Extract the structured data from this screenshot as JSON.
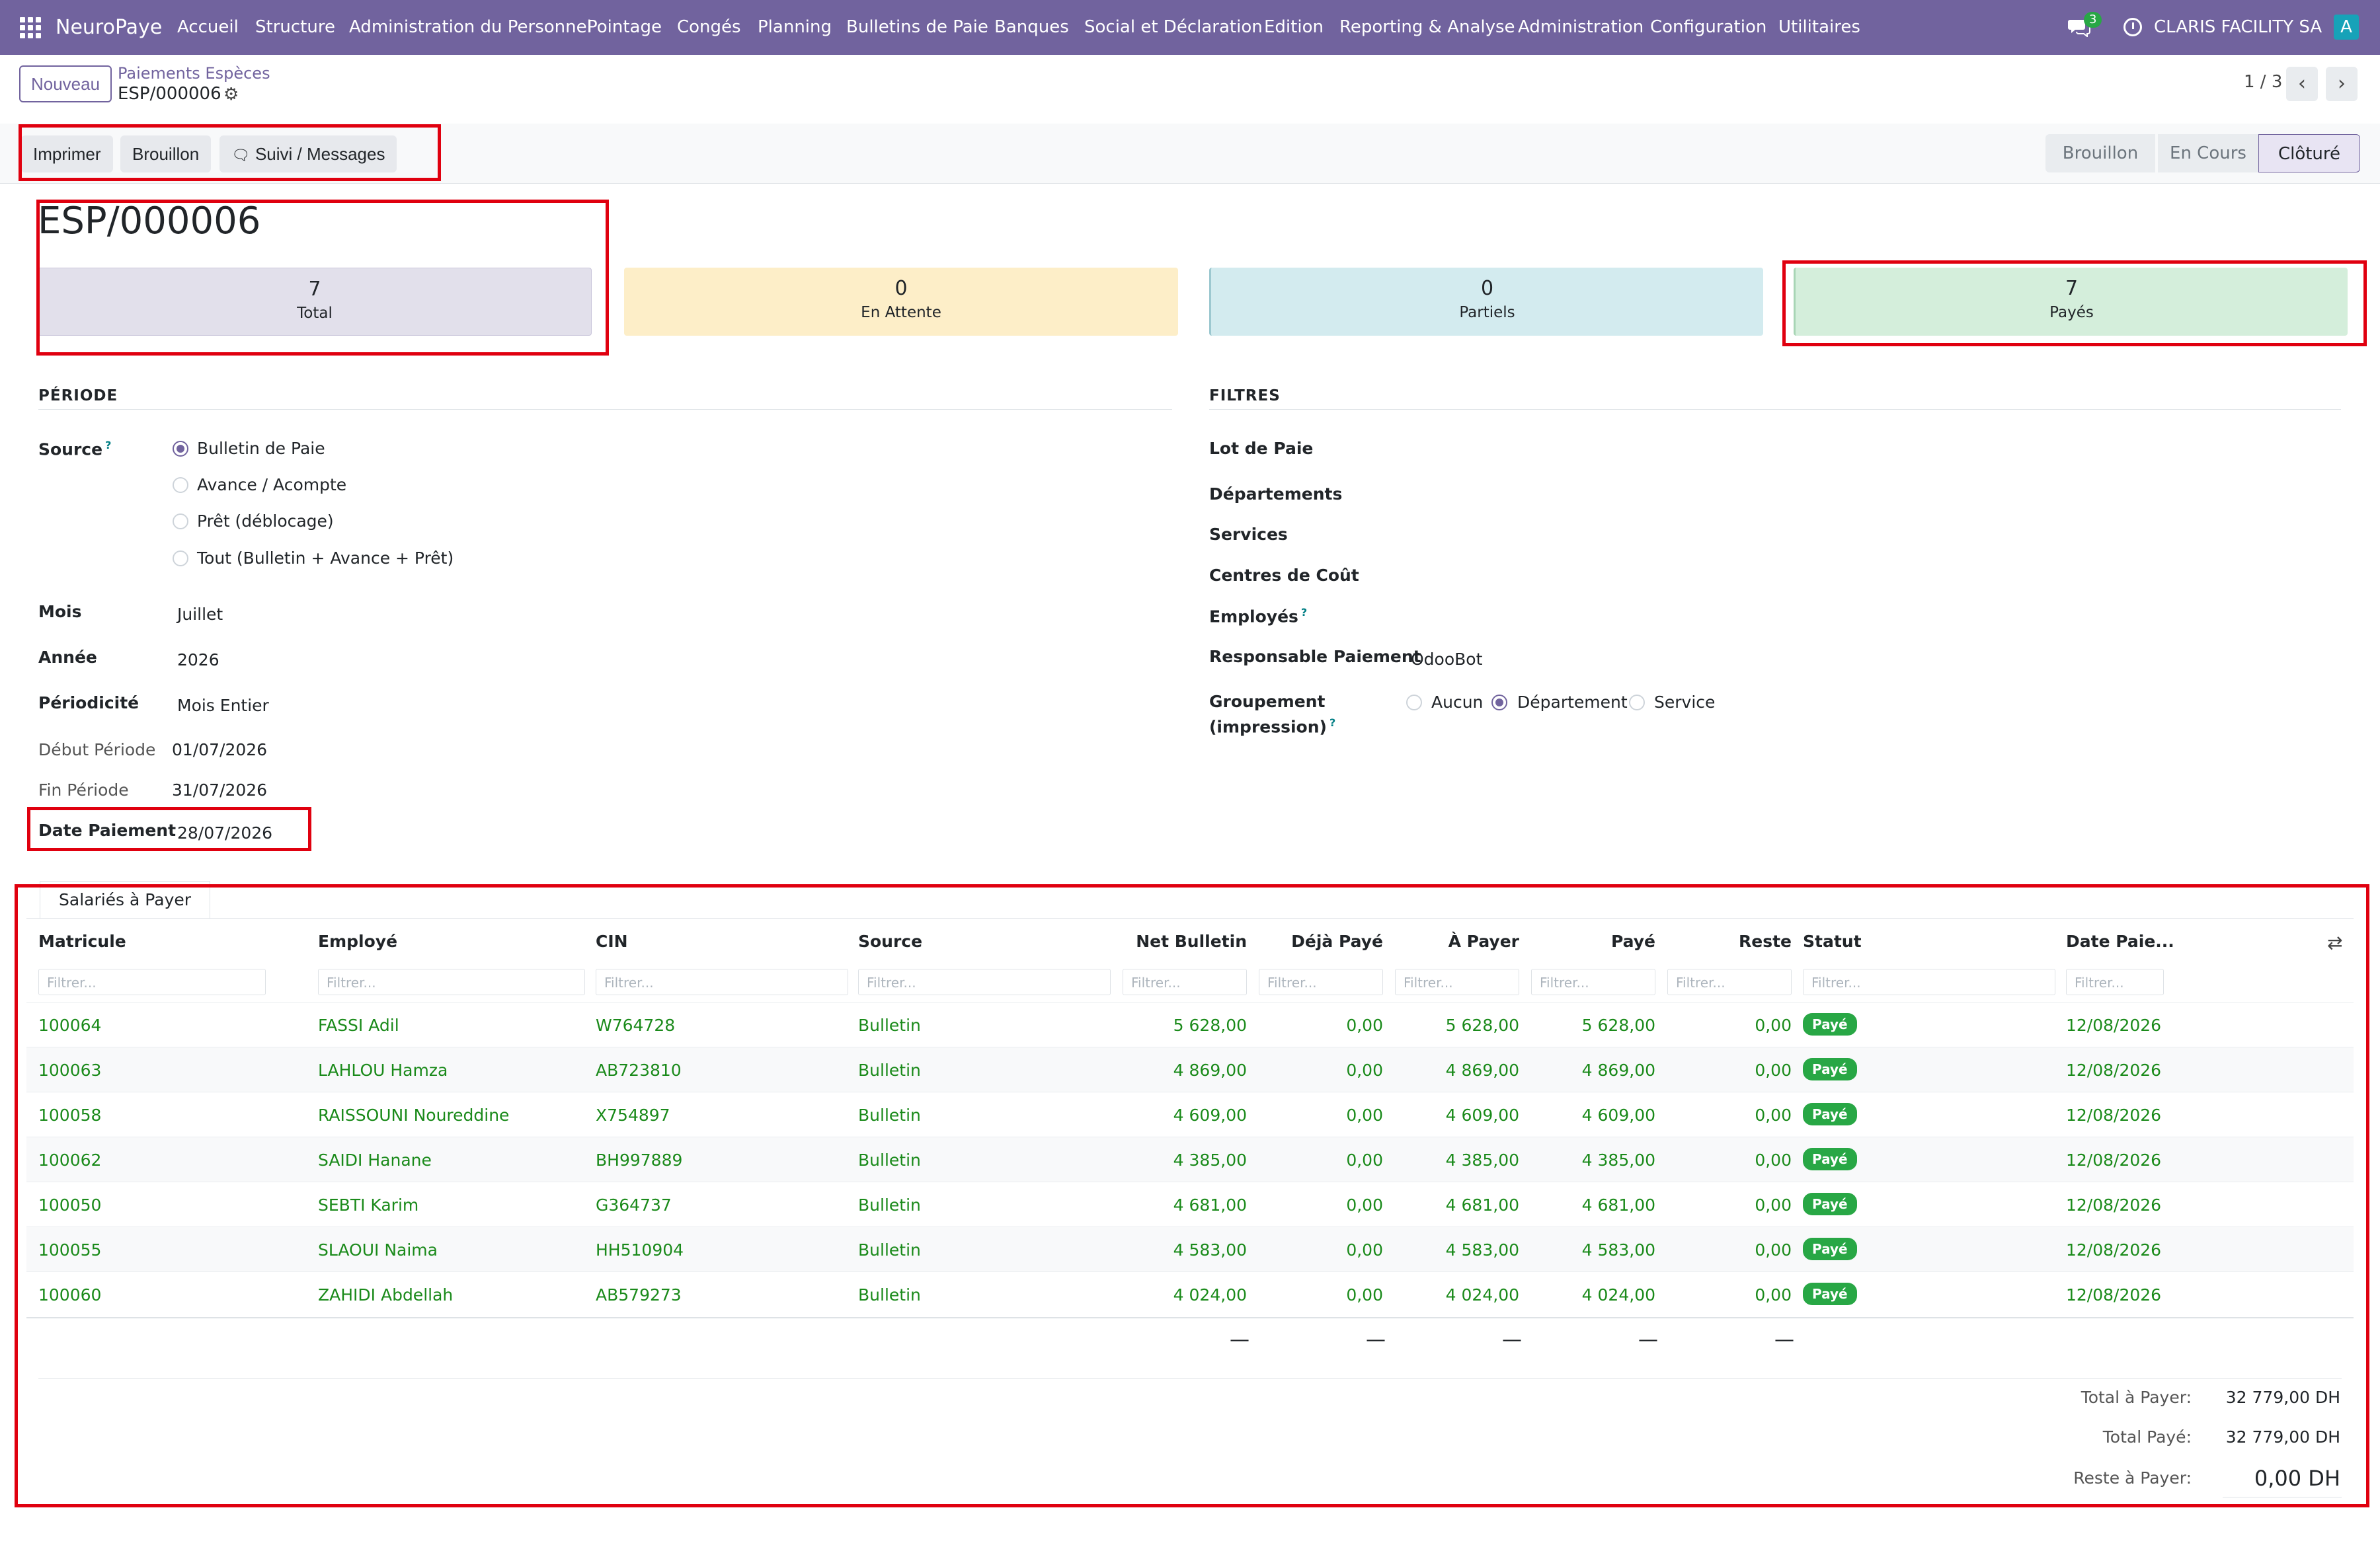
{
  "navbar": {
    "brand": "NeuroPaye",
    "menu": [
      "Accueil",
      "Structure",
      "Administration du Personnel",
      "Pointage",
      "Congés",
      "Planning",
      "Bulletins de Paie",
      "Banques",
      "Social et Déclaration",
      "Edition",
      "Reporting & Analyse",
      "Administration",
      "Configuration",
      "Utilitaires"
    ],
    "chat_badge": "3",
    "company": "CLARIS FACILITY SA",
    "avatar": "A"
  },
  "control": {
    "new_label": "Nouveau",
    "breadcrumb_parent": "Paiements Espèces",
    "breadcrumb_current": "ESP/000006",
    "pager": "1 / 3"
  },
  "actions": {
    "print": "Imprimer",
    "draft": "Brouillon",
    "messages": "Suivi / Messages"
  },
  "status": [
    "Brouillon",
    "En Cours",
    "Clôturé"
  ],
  "record": {
    "title": "ESP/000006",
    "stats": [
      {
        "num": "7",
        "label": "Total"
      },
      {
        "num": "0",
        "label": "En Attente"
      },
      {
        "num": "0",
        "label": "Partiels"
      },
      {
        "num": "7",
        "label": "Payés"
      }
    ]
  },
  "periode": {
    "title": "PÉRIODE",
    "source_label": "Source",
    "source_options": [
      "Bulletin de Paie",
      "Avance / Acompte",
      "Prêt (déblocage)",
      "Tout (Bulletin + Avance + Prêt)"
    ],
    "mois_label": "Mois",
    "mois": "Juillet",
    "annee_label": "Année",
    "annee": "2026",
    "periodicite_label": "Périodicité",
    "periodicite": "Mois Entier",
    "debut_label": "Début Période",
    "debut": "01/07/2026",
    "fin_label": "Fin Période",
    "fin": "31/07/2026",
    "date_paiement_label": "Date Paiement",
    "date_paiement": "28/07/2026"
  },
  "filtres": {
    "title": "FILTRES",
    "lot": "Lot de Paie",
    "departements": "Départements",
    "services": "Services",
    "centres": "Centres de Coût",
    "employes": "Employés",
    "responsable_label": "Responsable Paiement",
    "responsable": "OdooBot",
    "groupement_label_1": "Groupement",
    "groupement_label_2": "(impression)",
    "groupement_options": [
      "Aucun",
      "Département",
      "Service"
    ]
  },
  "table": {
    "tab": "Salariés à Payer",
    "headers": [
      "Matricule",
      "Employé",
      "CIN",
      "Source",
      "Net Bulletin",
      "Déjà Payé",
      "À Payer",
      "Payé",
      "Reste",
      "Statut",
      "Date Paie..."
    ],
    "filter_placeholder": "Filtrer...",
    "rows": [
      [
        "100064",
        "FASSI Adil",
        "W764728",
        "Bulletin",
        "5 628,00",
        "0,00",
        "5 628,00",
        "5 628,00",
        "0,00",
        "Payé",
        "12/08/2026"
      ],
      [
        "100063",
        "LAHLOU Hamza",
        "AB723810",
        "Bulletin",
        "4 869,00",
        "0,00",
        "4 869,00",
        "4 869,00",
        "0,00",
        "Payé",
        "12/08/2026"
      ],
      [
        "100058",
        "RAISSOUNI Noureddine",
        "X754897",
        "Bulletin",
        "4 609,00",
        "0,00",
        "4 609,00",
        "4 609,00",
        "0,00",
        "Payé",
        "12/08/2026"
      ],
      [
        "100062",
        "SAIDI Hanane",
        "BH997889",
        "Bulletin",
        "4 385,00",
        "0,00",
        "4 385,00",
        "4 385,00",
        "0,00",
        "Payé",
        "12/08/2026"
      ],
      [
        "100050",
        "SEBTI Karim",
        "G364737",
        "Bulletin",
        "4 681,00",
        "0,00",
        "4 681,00",
        "4 681,00",
        "0,00",
        "Payé",
        "12/08/2026"
      ],
      [
        "100055",
        "SLAOUI Naima",
        "HH510904",
        "Bulletin",
        "4 583,00",
        "0,00",
        "4 583,00",
        "4 583,00",
        "0,00",
        "Payé",
        "12/08/2026"
      ],
      [
        "100060",
        "ZAHIDI Abdellah",
        "AB579273",
        "Bulletin",
        "4 024,00",
        "0,00",
        "4 024,00",
        "4 024,00",
        "0,00",
        "Payé",
        "12/08/2026"
      ]
    ],
    "footer_dash": "—"
  },
  "totals": {
    "a_payer_label": "Total à Payer:",
    "a_payer": "32 779,00 DH",
    "paye_label": "Total Payé:",
    "paye": "32 779,00 DH",
    "reste_label": "Reste à Payer:",
    "reste": "0,00 DH"
  },
  "colors": {
    "brand": "#71639e",
    "accent_green": "#28a745",
    "highlight": "#e0000f"
  }
}
